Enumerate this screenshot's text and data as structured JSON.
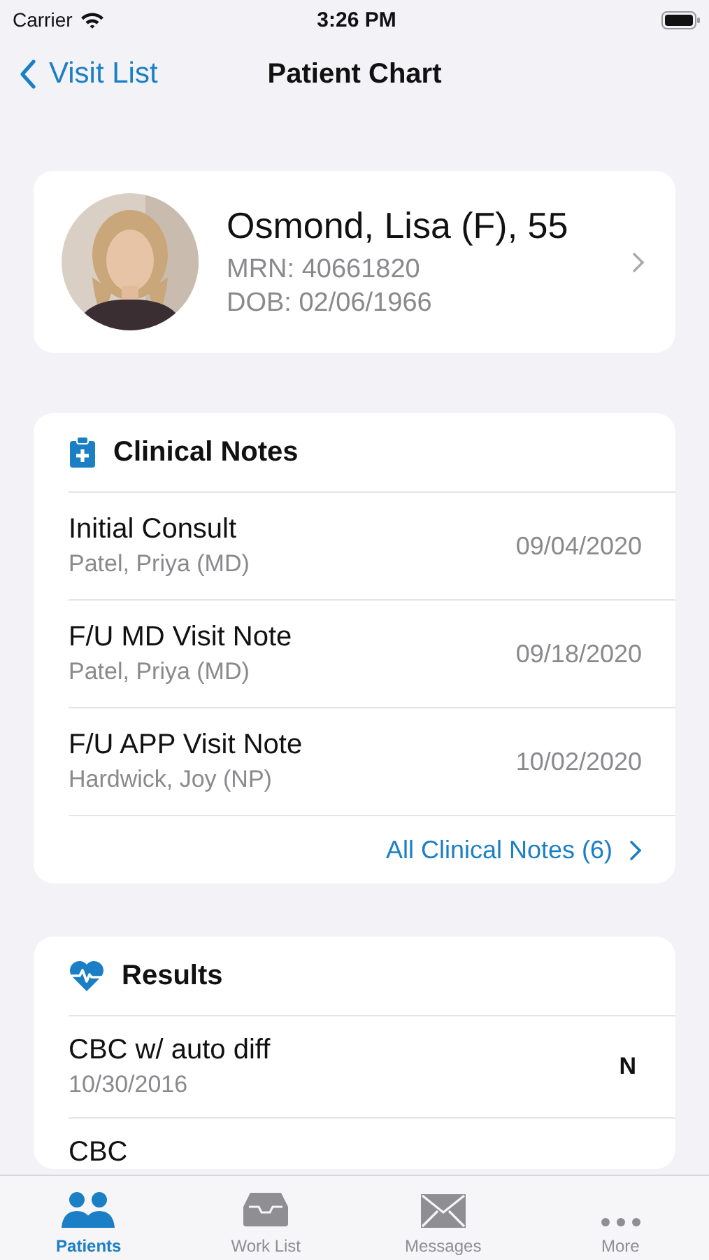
{
  "status_bar": {
    "carrier": "Carrier",
    "time": "3:26 PM"
  },
  "nav": {
    "back": "Visit List",
    "title": "Patient Chart"
  },
  "patient": {
    "name": "Osmond, Lisa (F), 55",
    "mrn": "MRN: 40661820",
    "dob": "DOB: 02/06/1966"
  },
  "clinical_notes": {
    "title": "Clinical Notes",
    "notes": [
      {
        "title": "Initial Consult",
        "author": "Patel, Priya (MD)",
        "date": "09/04/2020"
      },
      {
        "title": "F/U MD Visit Note",
        "author": "Patel, Priya (MD)",
        "date": "09/18/2020"
      },
      {
        "title": "F/U APP Visit Note",
        "author": "Hardwick, Joy (NP)",
        "date": "10/02/2020"
      }
    ],
    "all_link": "All Clinical Notes (6)"
  },
  "results": {
    "title": "Results",
    "rows": [
      {
        "name": "CBC w/ auto diff",
        "date": "10/30/2016",
        "flag": "N"
      },
      {
        "name": "CBC"
      }
    ]
  },
  "tab_bar": [
    {
      "label": "Patients",
      "selected": true,
      "kind": "people"
    },
    {
      "label": "Work List",
      "selected": false,
      "kind": "tray"
    },
    {
      "label": "Messages",
      "selected": false,
      "kind": "mail"
    },
    {
      "label": "More",
      "selected": false,
      "kind": "more"
    }
  ]
}
